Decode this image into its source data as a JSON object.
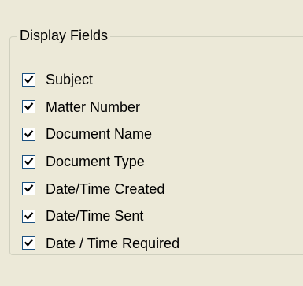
{
  "group": {
    "title": "Display Fields"
  },
  "fields": [
    {
      "label": "Subject",
      "checked": true
    },
    {
      "label": "Matter Number",
      "checked": true
    },
    {
      "label": "Document Name",
      "checked": true
    },
    {
      "label": "Document Type",
      "checked": true
    },
    {
      "label": "Date/Time Created",
      "checked": true
    },
    {
      "label": "Date/Time Sent",
      "checked": true
    },
    {
      "label": "Date / Time Required",
      "checked": true
    }
  ],
  "icons": {
    "check": "checkmark-icon"
  },
  "colors": {
    "background": "#ECE9D8",
    "checkbox_border": "#1C5180",
    "checkmark": "#000000"
  }
}
